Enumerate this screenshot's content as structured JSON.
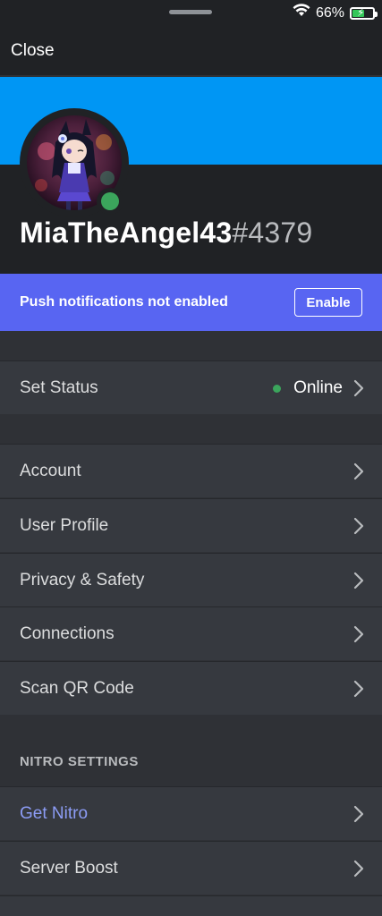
{
  "status_bar": {
    "battery_percent_label": "66%",
    "battery_level": 0.66,
    "icons": [
      "wifi-icon",
      "battery-charging-icon"
    ]
  },
  "header": {
    "close_label": "Close"
  },
  "colors": {
    "banner": "#0096f4",
    "push_bar": "#5865f2",
    "online": "#3ba55c",
    "nitro": "#8c9cf5"
  },
  "profile": {
    "username": "MiaTheAngel43",
    "discriminator": "#4379",
    "avatar_icon": "avatar-image",
    "status": "online"
  },
  "push_notice": {
    "text": "Push notifications not enabled",
    "button_label": "Enable"
  },
  "status_row": {
    "label": "Set Status",
    "value": "Online"
  },
  "settings": {
    "items": [
      {
        "label": "Account"
      },
      {
        "label": "User Profile"
      },
      {
        "label": "Privacy & Safety"
      },
      {
        "label": "Connections"
      },
      {
        "label": "Scan QR Code"
      }
    ]
  },
  "nitro": {
    "header": "NITRO SETTINGS",
    "items": [
      {
        "label": "Get Nitro"
      },
      {
        "label": "Server Boost"
      }
    ]
  }
}
